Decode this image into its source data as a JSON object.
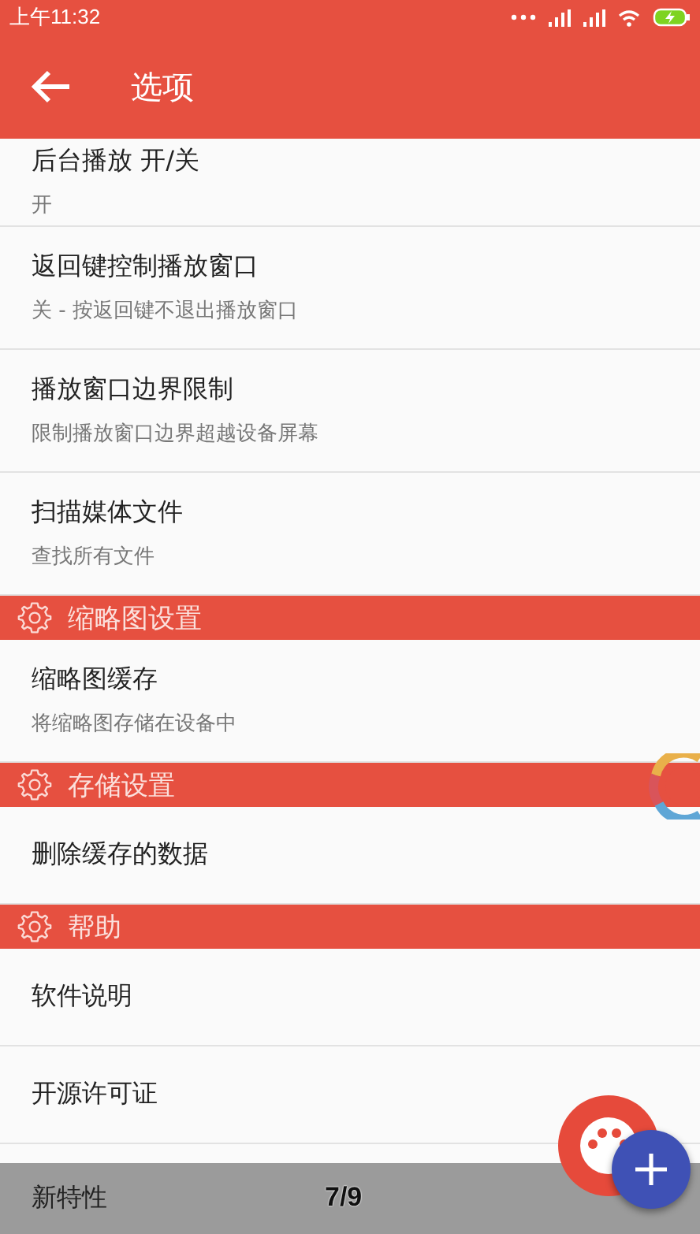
{
  "status_bar": {
    "time": "上午11:32"
  },
  "app_bar": {
    "title": "选项"
  },
  "list": [
    {
      "kind": "item",
      "title": "后台播放 开/关",
      "subtitle": "开"
    },
    {
      "kind": "item",
      "title": "返回键控制播放窗口",
      "subtitle": "关 - 按返回键不退出播放窗口"
    },
    {
      "kind": "item",
      "title": "播放窗口边界限制",
      "subtitle": "限制播放窗口边界超越设备屏幕"
    },
    {
      "kind": "item",
      "title": "扫描媒体文件",
      "subtitle": "查找所有文件"
    },
    {
      "kind": "header",
      "title": "缩略图设置"
    },
    {
      "kind": "item",
      "title": "缩略图缓存",
      "subtitle": "将缩略图存储在设备中"
    },
    {
      "kind": "header",
      "title": "存储设置"
    },
    {
      "kind": "item",
      "title": "删除缓存的数据"
    },
    {
      "kind": "header",
      "title": "帮助"
    },
    {
      "kind": "item",
      "title": "软件说明"
    },
    {
      "kind": "item",
      "title": "开源许可证"
    }
  ],
  "bottom_bar": {
    "label": "新特性",
    "counter": "7/9"
  }
}
